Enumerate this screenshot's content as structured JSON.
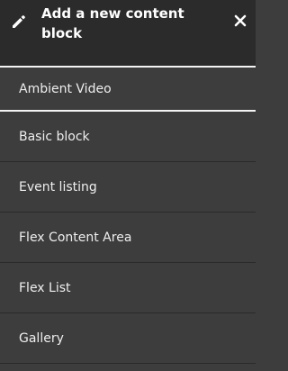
{
  "dialog": {
    "title": "Add a new content block",
    "icons": {
      "edit": "pencil-icon",
      "close": "close-icon"
    },
    "colors": {
      "header_bg": "#2b2b2b",
      "list_bg": "#3d3d3d",
      "divider": "#f4f4f4",
      "text": "#ffffff"
    }
  },
  "blocks": [
    {
      "label": "Ambient Video"
    },
    {
      "label": "Basic block"
    },
    {
      "label": "Event listing"
    },
    {
      "label": "Flex Content Area"
    },
    {
      "label": "Flex List"
    },
    {
      "label": "Gallery"
    }
  ]
}
